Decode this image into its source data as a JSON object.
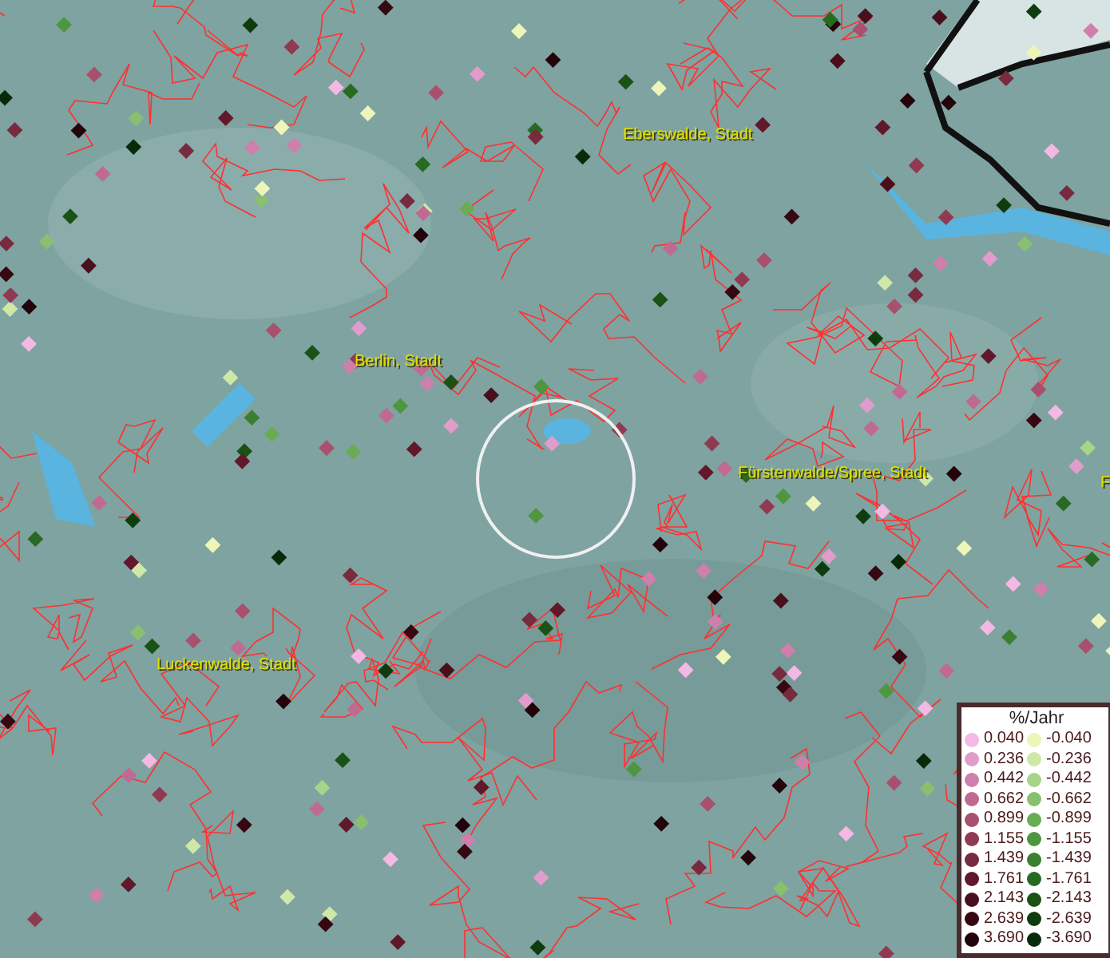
{
  "map": {
    "places": [
      {
        "name": "Eberswalde, Stadt"
      },
      {
        "name": "Berlin, Stadt"
      },
      {
        "name": "Fürstenwalde/Spree, Stadt"
      },
      {
        "name": "Luckenwalde, Stadt"
      },
      {
        "name": "F"
      }
    ]
  },
  "legend": {
    "title": "%/Jahr",
    "positive": [
      {
        "value": "0.040",
        "color": "#f4b8e4"
      },
      {
        "value": "0.236",
        "color": "#e29ccc"
      },
      {
        "value": "0.442",
        "color": "#cf7fac"
      },
      {
        "value": "0.662",
        "color": "#c06a92"
      },
      {
        "value": "0.899",
        "color": "#a8506e"
      },
      {
        "value": "1.155",
        "color": "#903a52"
      },
      {
        "value": "1.439",
        "color": "#782a3e"
      },
      {
        "value": "1.761",
        "color": "#60182a"
      },
      {
        "value": "2.143",
        "color": "#4a0f1c"
      },
      {
        "value": "2.639",
        "color": "#360812"
      },
      {
        "value": "3.690",
        "color": "#22040a"
      }
    ],
    "negative": [
      {
        "value": "-0.040",
        "color": "#eef5b8"
      },
      {
        "value": "-0.236",
        "color": "#cfe8a8"
      },
      {
        "value": "-0.442",
        "color": "#a8d48a"
      },
      {
        "value": "-0.662",
        "color": "#88c070"
      },
      {
        "value": "-0.899",
        "color": "#6aac54"
      },
      {
        "value": "-1.155",
        "color": "#4e9640"
      },
      {
        "value": "-1.439",
        "color": "#3a8030"
      },
      {
        "value": "-1.761",
        "color": "#286a22"
      },
      {
        "value": "-2.143",
        "color": "#1a5216"
      },
      {
        "value": "-2.639",
        "color": "#0e3c0e"
      },
      {
        "value": "-3.690",
        "color": "#082a08"
      }
    ]
  }
}
